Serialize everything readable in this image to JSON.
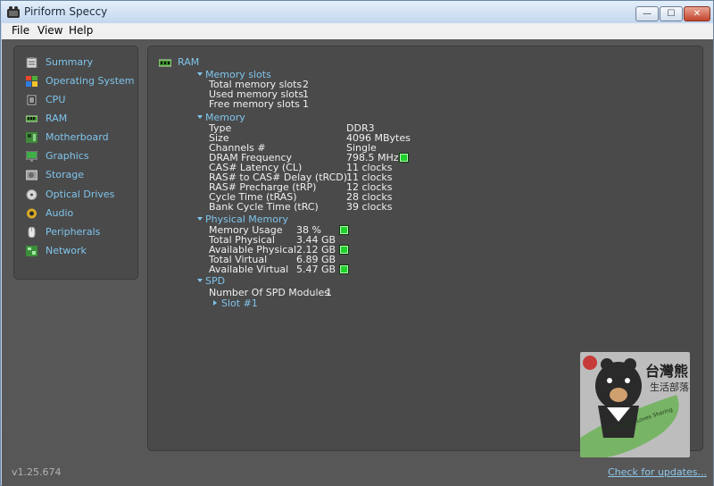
{
  "window": {
    "title": "Piriform Speccy",
    "min_glyph": "—",
    "max_glyph": "☐",
    "close_glyph": "✕"
  },
  "menubar": [
    "File",
    "View",
    "Help"
  ],
  "sidebar": [
    {
      "label": "Summary",
      "icon": "clipboard-icon"
    },
    {
      "label": "Operating System",
      "icon": "windows-logo-icon"
    },
    {
      "label": "CPU",
      "icon": "cpu-chip-icon"
    },
    {
      "label": "RAM",
      "icon": "ram-module-icon"
    },
    {
      "label": "Motherboard",
      "icon": "motherboard-icon"
    },
    {
      "label": "Graphics",
      "icon": "monitor-icon"
    },
    {
      "label": "Storage",
      "icon": "hard-drive-icon"
    },
    {
      "label": "Optical Drives",
      "icon": "optical-disc-icon"
    },
    {
      "label": "Audio",
      "icon": "speaker-icon"
    },
    {
      "label": "Peripherals",
      "icon": "mouse-icon"
    },
    {
      "label": "Network",
      "icon": "network-icon"
    }
  ],
  "content": {
    "heading": "RAM",
    "memory_slots": {
      "title": "Memory slots",
      "rows": [
        {
          "label": "Total memory slots",
          "value": "2"
        },
        {
          "label": "Used memory slots",
          "value": "1"
        },
        {
          "label": "Free memory slots",
          "value": "1"
        }
      ]
    },
    "memory": {
      "title": "Memory",
      "rows": [
        {
          "label": "Type",
          "value": "DDR3"
        },
        {
          "label": "Size",
          "value": "4096 MBytes"
        },
        {
          "label": "Channels #",
          "value": "Single"
        },
        {
          "label": "DRAM Frequency",
          "value": "798.5 MHz"
        },
        {
          "label": "CAS# Latency (CL)",
          "value": "11 clocks"
        },
        {
          "label": "RAS# to CAS# Delay (tRCD)",
          "value": "11 clocks"
        },
        {
          "label": "RAS# Precharge (tRP)",
          "value": "12 clocks"
        },
        {
          "label": "Cycle Time (tRAS)",
          "value": "28 clocks"
        },
        {
          "label": "Bank Cycle Time (tRC)",
          "value": "39 clocks"
        }
      ]
    },
    "physical_memory": {
      "title": "Physical Memory",
      "rows": [
        {
          "label": "Memory Usage",
          "value": "38 %"
        },
        {
          "label": "Total Physical",
          "value": "3.44 GB"
        },
        {
          "label": "Available Physical",
          "value": "2.12 GB"
        },
        {
          "label": "Total Virtual",
          "value": "6.89 GB"
        },
        {
          "label": "Available Virtual",
          "value": "5.47 GB"
        }
      ]
    },
    "spd": {
      "title": "SPD",
      "modules_label": "Number Of SPD Modules",
      "modules_value": "1",
      "slot": "Slot #1"
    }
  },
  "watermark": {
    "name": "台灣熊",
    "tagline": "生活部落",
    "note": "Taiwan Bear Loves Sharing"
  },
  "status": {
    "version": "v1.25.674",
    "updates": "Check for updates..."
  },
  "colors": {
    "background": "#575757",
    "panel": "#4a4a4a",
    "link": "#7fc4ec",
    "indicator": "#1fd22c"
  }
}
